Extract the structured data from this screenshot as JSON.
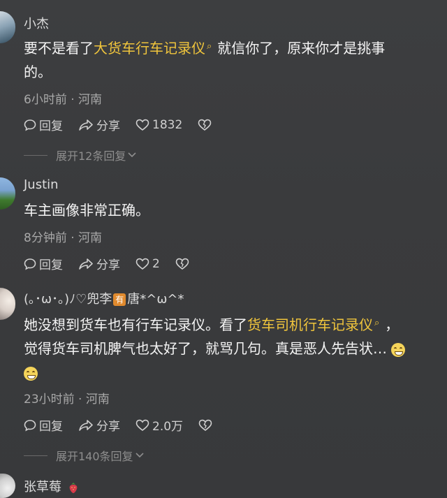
{
  "comments": [
    {
      "username": "小杰",
      "text_before": "要不是看了",
      "highlight": "大货车行车记录仪",
      "text_after_line1": "就信你了，原来你才是挑事",
      "text_line2": "的。",
      "meta": "6小时前 · 河南",
      "reply_label": "回复",
      "share_label": "分享",
      "likes": "1832",
      "expand": "展开12条回复"
    },
    {
      "username": "Justin",
      "text": "车主画像非常正确。",
      "meta": "8分钟前 · 河南",
      "reply_label": "回复",
      "share_label": "分享",
      "likes": "2"
    },
    {
      "username_before": "(｡･ω･｡)ﾉ♡兜李",
      "username_badge": "有",
      "username_after": "唐*^ω^*",
      "text_line1": "她没想到货车也有行车记录仪。看了",
      "highlight": "货车司机行车记录仪",
      "text_line1_end": "，",
      "text_line2": "觉得货车司机脾气也太好了，就骂几句。真是恶人先告状…",
      "meta": "23小时前 · 河南",
      "reply_label": "回复",
      "share_label": "分享",
      "likes": "2.0万",
      "expand": "展开140条回复"
    },
    {
      "username": "张草莓"
    }
  ],
  "colors": {
    "background": "#3a3b3d",
    "highlight": "#f0c53c",
    "meta": "#a9a9a9"
  },
  "icons": {
    "reply": "comment-bubble-icon",
    "share": "share-arrow-icon",
    "like": "heart-icon",
    "dislike": "broken-heart-icon",
    "chevron": "chevron-down-icon",
    "search": "search-icon"
  }
}
